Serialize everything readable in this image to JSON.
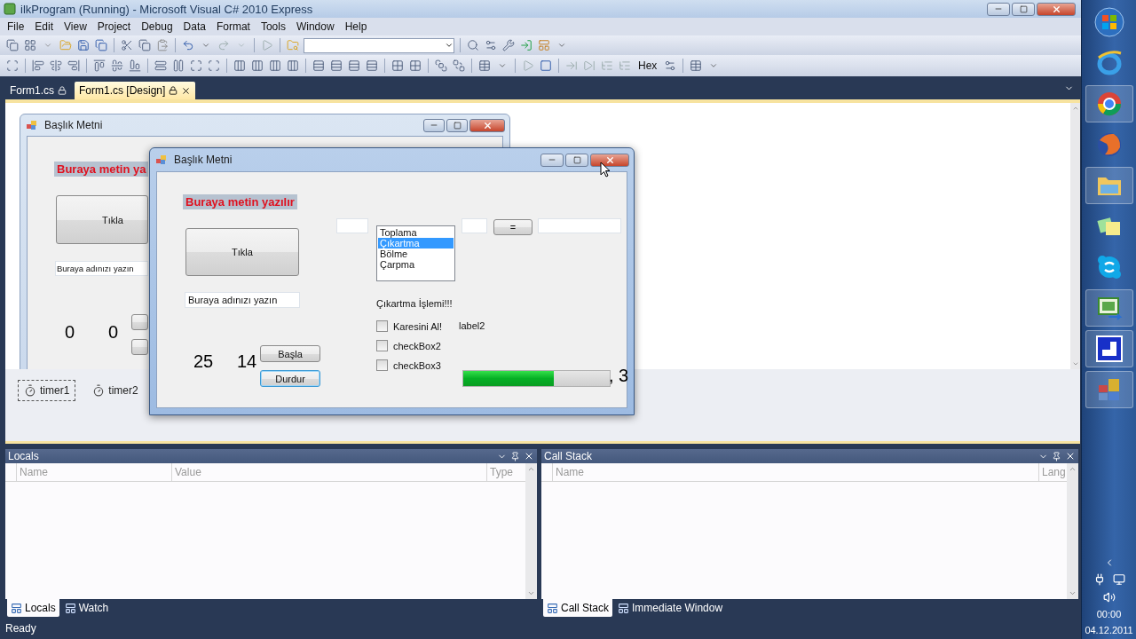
{
  "window": {
    "title": "ilkProgram (Running) - Microsoft Visual C# 2010 Express"
  },
  "menu": [
    "File",
    "Edit",
    "View",
    "Project",
    "Debug",
    "Data",
    "Format",
    "Tools",
    "Window",
    "Help"
  ],
  "toolbar": {
    "hex_button": "Hex"
  },
  "document_tabs": [
    {
      "label": "Form1.cs",
      "selected": false
    },
    {
      "label": "Form1.cs [Design]",
      "selected": true
    }
  ],
  "designer": {
    "form": {
      "title": "Başlık Metni",
      "heading": "Buraya metin ya",
      "click_button": "Tıkla",
      "name_field": "Buraya adınızı yazın",
      "counters": [
        "0",
        "0"
      ]
    },
    "tray": [
      {
        "label": "timer1",
        "selected": true
      },
      {
        "label": "timer2",
        "selected": false
      }
    ]
  },
  "running_form": {
    "title": "Başlık Metni",
    "heading": "Buraya metin yazılır",
    "click_button": "Tıkla",
    "name_field": "Buraya adınızı yazın",
    "counters": [
      "25",
      "14"
    ],
    "start_button": "Başla",
    "stop_button": {
      "label": "Durdur",
      "focused": true
    },
    "operations": [
      {
        "label": "Toplama",
        "selected": false
      },
      {
        "label": "Çıkartma",
        "selected": true
      },
      {
        "label": "Bölme",
        "selected": false
      },
      {
        "label": "Çarpma",
        "selected": false
      }
    ],
    "equals_button": "=",
    "operation_label": "Çıkartma İşlemi!!!",
    "checkboxes": [
      {
        "label": "Karesini Al!",
        "checked": false
      },
      {
        "label": "checkBox2",
        "checked": false
      },
      {
        "label": "checkBox3",
        "checked": false
      }
    ],
    "result_label": "label2",
    "progress": {
      "level": 0.62
    },
    "sequence_text": ", 3"
  },
  "locals": {
    "title": "Locals",
    "columns": [
      "Name",
      "Value",
      "Type"
    ],
    "tabs": [
      {
        "label": "Locals",
        "selected": true
      },
      {
        "label": "Watch",
        "selected": false
      }
    ]
  },
  "call_stack": {
    "title": "Call Stack",
    "columns": [
      "Name",
      "Lang"
    ],
    "tabs": [
      {
        "label": "Call Stack",
        "selected": true
      },
      {
        "label": "Immediate Window",
        "selected": false
      }
    ]
  },
  "status_bar": "Ready",
  "taskbar": {
    "items": [
      {
        "kind": "orb",
        "running": false
      },
      {
        "kind": "ring",
        "running": false
      },
      {
        "kind": "wheel",
        "running": true
      },
      {
        "kind": "globe",
        "running": false
      },
      {
        "kind": "folder",
        "running": true
      },
      {
        "kind": "notes",
        "running": false
      },
      {
        "kind": "bubble",
        "running": false
      },
      {
        "kind": "code",
        "running": true
      },
      {
        "kind": "window",
        "running": true
      },
      {
        "kind": "tiles",
        "running": true
      }
    ],
    "time": "00:00",
    "date": "04.12.2011"
  }
}
